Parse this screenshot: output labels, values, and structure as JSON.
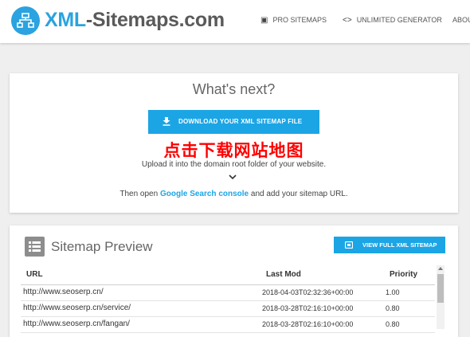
{
  "header": {
    "logo_xml": "XML",
    "logo_rest": "-Sitemaps.com",
    "nav": [
      {
        "icon": "diamond-icon",
        "label": "PRO SITEMAPS"
      },
      {
        "icon": "code-brackets-icon",
        "label": "UNLIMITED GENERATOR"
      },
      {
        "icon": "",
        "label": "ABOU"
      }
    ]
  },
  "next": {
    "title": "What's next?",
    "download_label": "DOWNLOAD YOUR XML SITEMAP FILE",
    "chinese_note": "点击下载网站地图",
    "upload_text": "Upload it into the domain root folder of your website.",
    "then_prefix": "Then open ",
    "then_link": "Google Search console",
    "then_suffix": " and add your sitemap URL."
  },
  "preview": {
    "title": "Sitemap Preview",
    "view_full_label": "VIEW FULL XML SITEMAP",
    "columns": {
      "url": "URL",
      "lastmod": "Last Mod",
      "priority": "Priority"
    },
    "rows": [
      {
        "url": "http://www.seoserp.cn/",
        "lastmod": "2018-04-03T02:32:36+00:00",
        "priority": "1.00"
      },
      {
        "url": "http://www.seoserp.cn/service/",
        "lastmod": "2018-03-28T02:16:10+00:00",
        "priority": "0.80"
      },
      {
        "url": "http://www.seoserp.cn/fangan/",
        "lastmod": "2018-03-28T02:16:10+00:00",
        "priority": "0.80"
      }
    ]
  },
  "colors": {
    "accent": "#1ca5e5",
    "chinese_note": "#ff0000",
    "background": "#efefef"
  }
}
